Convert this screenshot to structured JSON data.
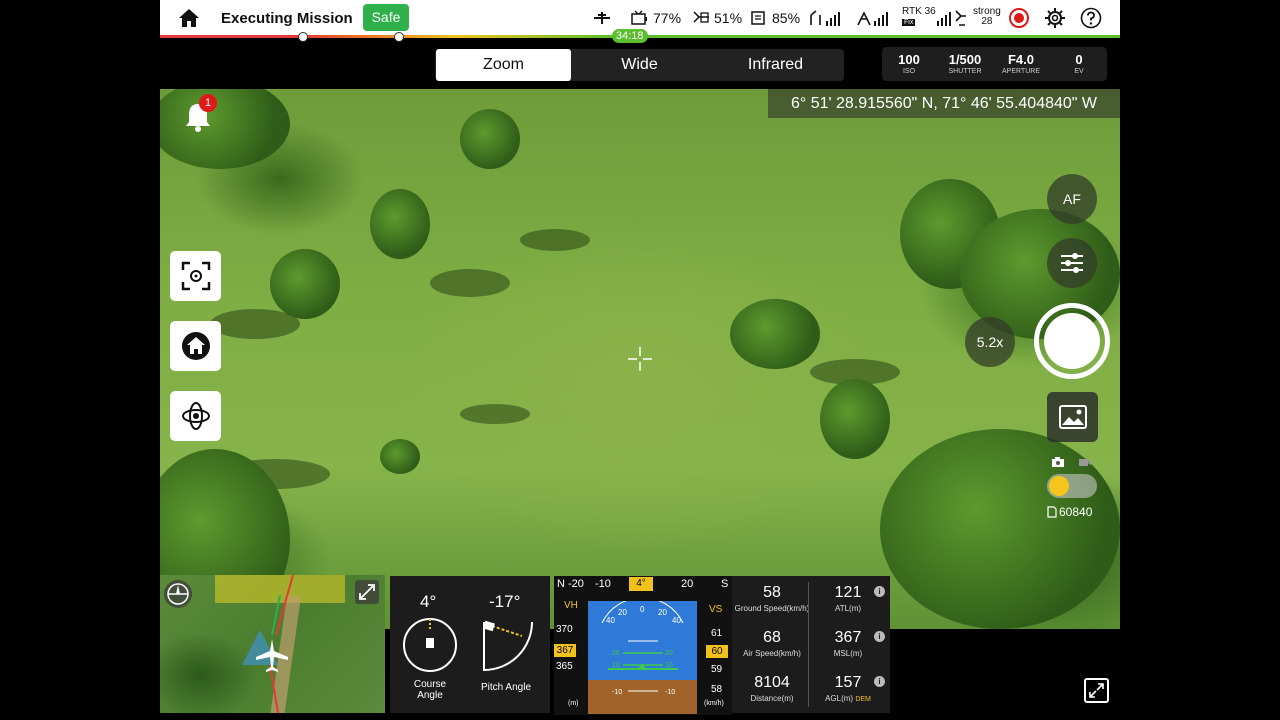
{
  "topbar": {
    "title": "Executing Mission",
    "safety_status": "Safe",
    "stats": {
      "aircraft_icon": "aircraft-icon",
      "rc_battery": "77%",
      "aircraft_battery": "51%",
      "other_battery": "85%"
    },
    "rtk": {
      "label": "RTK",
      "value": "36",
      "sub": "Fix"
    },
    "signal": {
      "label": "strong",
      "value": "28"
    },
    "mission_time": "34:18"
  },
  "lens_tabs": [
    {
      "label": "Zoom",
      "active": true
    },
    {
      "label": "Wide",
      "active": false
    },
    {
      "label": "Infrared",
      "active": false
    }
  ],
  "camera_params": [
    {
      "value": "100",
      "label": "ISO"
    },
    {
      "value": "1/500",
      "label": "SHUTTER"
    },
    {
      "value": "F4.0",
      "label": "APERTURE"
    },
    {
      "value": "0",
      "label": "EV"
    }
  ],
  "coordinates": "6° 51' 28.915560\" N, 71° 46' 55.404840\" W",
  "notifications": {
    "count": "1"
  },
  "right_controls": {
    "af_label": "AF",
    "zoom_label": "5.2x",
    "storage": "60840"
  },
  "attitude": {
    "course_value": "4°",
    "pitch_value": "-17°",
    "course_label": "Course\nAngle",
    "pitch_label": "Pitch Angle"
  },
  "pfd": {
    "heading_ticks": [
      "N",
      "-20",
      "-10",
      "20",
      "S"
    ],
    "heading_value": "4°",
    "vh_label": "VH",
    "vs_label": "VS",
    "left_tape": [
      "370",
      "365"
    ],
    "left_value": "367",
    "left_unit": "(m)",
    "right_tape": [
      "61",
      "59",
      "58"
    ],
    "right_value": "60",
    "right_unit": "(km/h)",
    "pitch_marks": [
      "40",
      "20",
      "0",
      "20",
      "40",
      "20",
      "10",
      "10"
    ]
  },
  "telemetry": [
    {
      "value": "58",
      "label": "Ground Speed(km/h)"
    },
    {
      "value": "121",
      "label": "ATL(m)"
    },
    {
      "value": "68",
      "label": "Air Speed(km/h)"
    },
    {
      "value": "367",
      "label": "MSL(m)"
    },
    {
      "value": "8104",
      "label": "Distance(m)"
    },
    {
      "value": "157",
      "label": "AGL(m)",
      "badge": "DEM"
    }
  ],
  "colors": {
    "safe": "#2fb04a",
    "accent": "#f2c21b",
    "badge": "#e01818",
    "time_badge": "#5bbf2d"
  }
}
